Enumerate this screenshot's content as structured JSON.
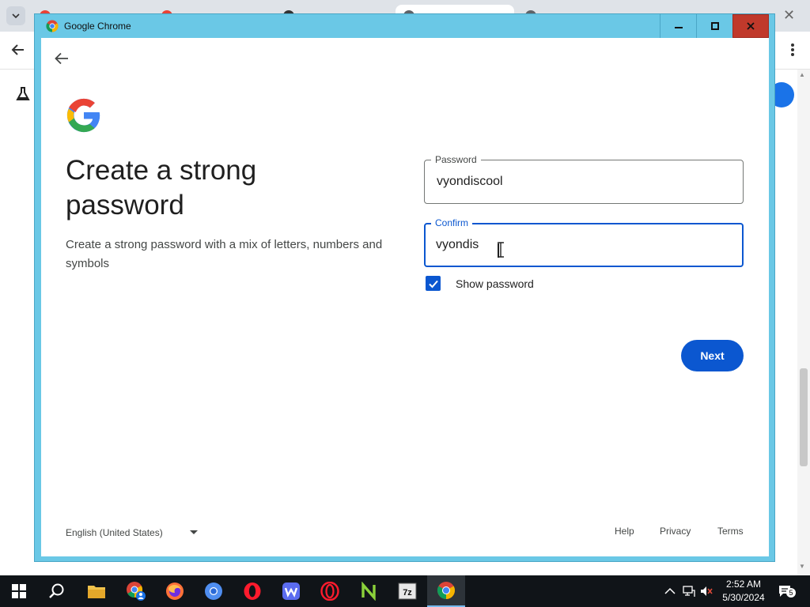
{
  "window": {
    "title": "Google Chrome"
  },
  "background_browser": {
    "tabs": [
      {
        "label": "...",
        "color": "#e94235"
      },
      {
        "label": "...",
        "color": "#e94235"
      },
      {
        "label": "...",
        "color": "#333333"
      },
      {
        "label": "...",
        "color": "#5f6368"
      },
      {
        "label": "...",
        "color": "#5f6368"
      }
    ]
  },
  "form": {
    "heading": "Create a strong password",
    "description": "Create a strong password with a mix of letters, numbers and symbols",
    "password_label": "Password",
    "password_value": "vyondiscool",
    "confirm_label": "Confirm",
    "confirm_value": "vyondis",
    "show_password_label": "Show password",
    "show_password_checked": true,
    "next_label": "Next"
  },
  "footer": {
    "language": "English (United States)",
    "help": "Help",
    "privacy": "Privacy",
    "terms": "Terms"
  },
  "taskbar": {
    "apps": [
      "start",
      "search",
      "file-explorer",
      "chrome-profile",
      "firefox",
      "chromium",
      "opera",
      "waterfox",
      "opera-gx",
      "notepad-plus-plus",
      "7zip",
      "chrome"
    ],
    "time": "2:52 AM",
    "date": "5/30/2024",
    "notification_count": "5"
  },
  "colors": {
    "window_border": "#6ac8e6",
    "primary_blue": "#0b57d0",
    "close_red": "#c0392b"
  }
}
